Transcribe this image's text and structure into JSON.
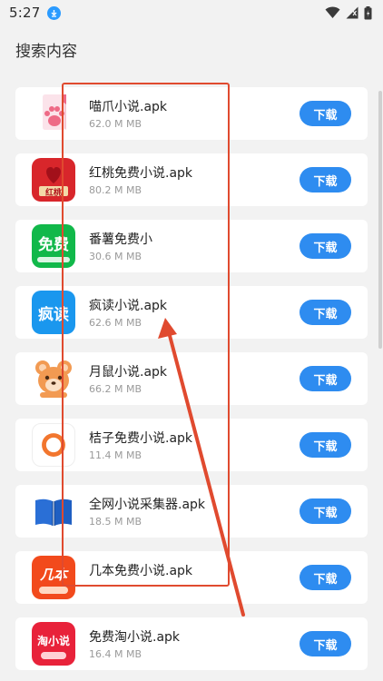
{
  "status_bar": {
    "time": "5:27",
    "icons": [
      "download-badge-icon",
      "wifi-icon",
      "signal-icon",
      "battery-icon"
    ]
  },
  "header": {
    "title": "搜索内容"
  },
  "colors": {
    "accent": "#2e8cf0",
    "annotation": "#e04a2f",
    "card_bg": "#ffffff",
    "page_bg": "#f2f2f2"
  },
  "apps": [
    {
      "name": "喵爪小说.apk",
      "size": "62.0 M MB",
      "icon": "cat-paw-icon",
      "button": "下载"
    },
    {
      "name": "红桃免费小说.apk",
      "size": "80.2 M MB",
      "icon": "red-heart-book-icon",
      "button": "下载",
      "icon_text": "红桃"
    },
    {
      "name": "番薯免费小",
      "size": "30.6 M MB",
      "icon": "free-text-icon",
      "button": "下载",
      "icon_text": "免费"
    },
    {
      "name": "疯读小说.apk",
      "size": "62.6 M MB",
      "icon": "fengdu-icon",
      "button": "下载",
      "icon_text": "疯读"
    },
    {
      "name": "月鼠小说.apk",
      "size": "66.2 M MB",
      "icon": "mouse-face-icon",
      "button": "下载"
    },
    {
      "name": "桔子免费小说.apk",
      "size": "11.4 M MB",
      "icon": "orange-ring-icon",
      "button": "下载"
    },
    {
      "name": "全网小说采集器.apk",
      "size": "18.5 M MB",
      "icon": "open-book-icon",
      "button": "下载"
    },
    {
      "name": "几本免费小说.apk",
      "size": "",
      "icon": "jiben-icon",
      "button": "下载",
      "icon_text": "几本"
    },
    {
      "name": "免费淘小说.apk",
      "size": "16.4 M MB",
      "icon": "taoxiaoshuo-icon",
      "button": "下载",
      "icon_text": "淘小说"
    }
  ]
}
